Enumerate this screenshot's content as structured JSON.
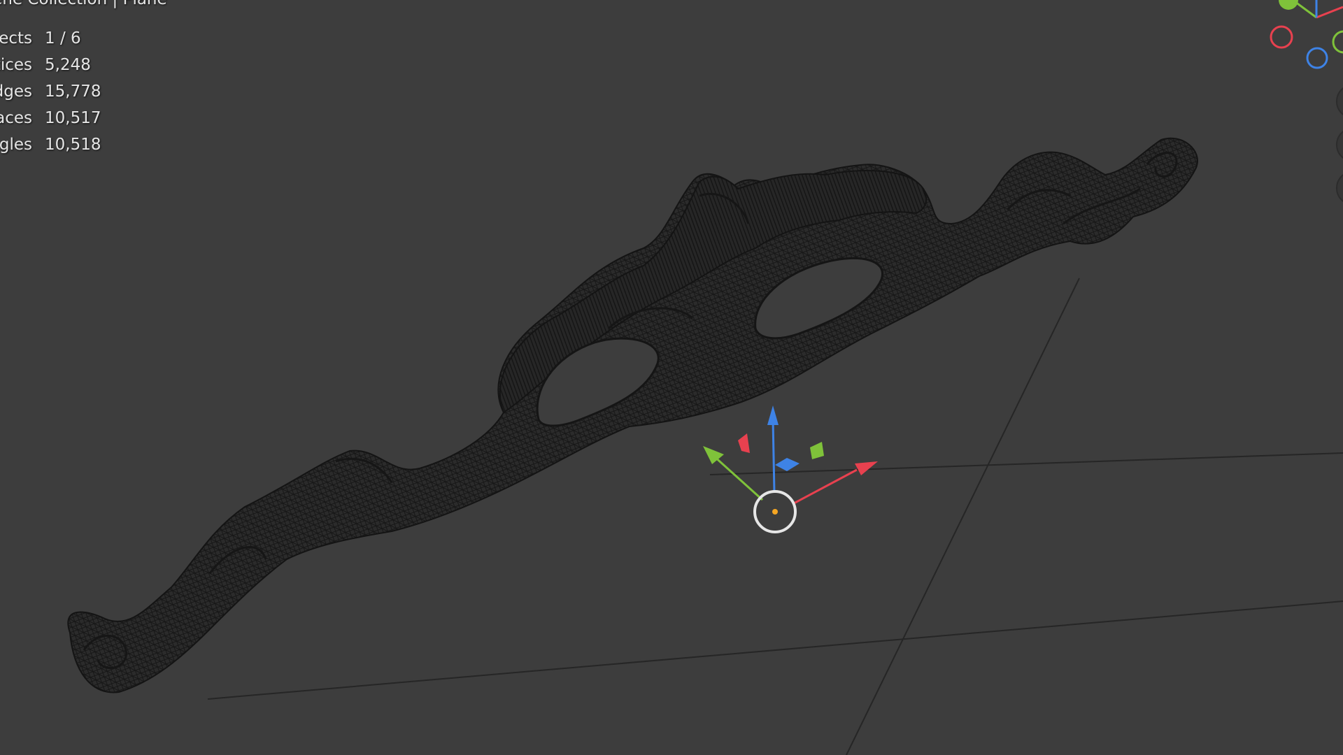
{
  "viewport": {
    "collection_title": "Scene Collection | Plane",
    "stats": [
      {
        "label": "Objects",
        "value": "1 / 6"
      },
      {
        "label": "Vertices",
        "value": "5,248"
      },
      {
        "label": "Edges",
        "value": "15,778"
      },
      {
        "label": "Faces",
        "value": "10,517"
      },
      {
        "label": "Triangles",
        "value": "10,518"
      }
    ],
    "background_color": "#3d3d3d",
    "axis_colors": {
      "x": "#e8414f",
      "y": "#7fc23a",
      "z": "#3e83e6"
    },
    "gizmo": {
      "type": "transform-move-gizmo",
      "origin_color": "#f5a623"
    },
    "navigation_gizmo_icon": "axis-orientation-icon",
    "object_display": "wireframe"
  }
}
